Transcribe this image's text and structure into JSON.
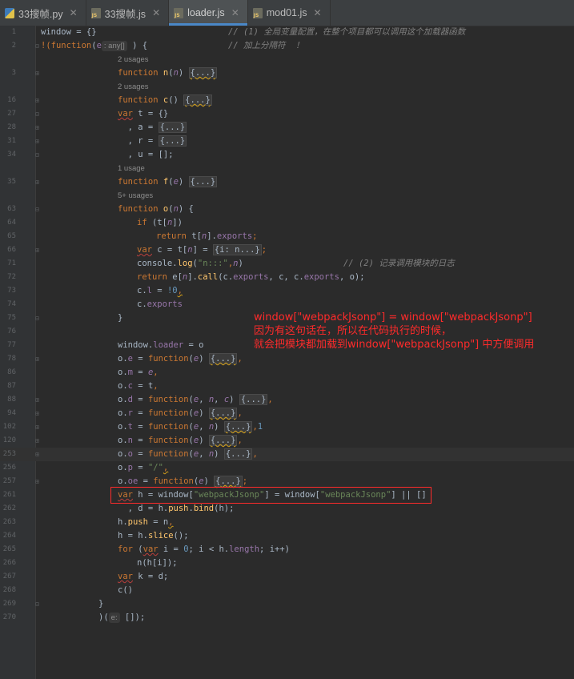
{
  "tabs": [
    {
      "label": "33搜帧.py",
      "icon": "python-file-icon",
      "active": false
    },
    {
      "label": "33搜帧.js",
      "icon": "js-file-icon",
      "active": false
    },
    {
      "label": "loader.js",
      "icon": "js-file-icon",
      "active": true
    },
    {
      "label": "mod01.js",
      "icon": "js-file-icon",
      "active": false
    }
  ],
  "lines": {
    "l1": {
      "num": "1",
      "t0": "window = {}",
      "comment": "// (1) 全局变量配置，在整个项目都可以调用这个加载器函数"
    },
    "l2": {
      "num": "2",
      "t0": "!(",
      "t1": "function",
      "t2": "(",
      "t3": "e",
      "hint": ": any[]",
      "t4": " ) {",
      "comment": "// 加上分隔符  ！"
    },
    "u1": "2 usages",
    "l3": {
      "num": "3",
      "t0": "function ",
      "t1": "n",
      "t2": "(",
      "t3": "n",
      "t4": ") ",
      "t5": "{...}"
    },
    "u2": "2 usages",
    "l16": {
      "num": "16",
      "t0": "function ",
      "t1": "c",
      "t2": "() ",
      "t3": "{...}"
    },
    "l27": {
      "num": "27",
      "t0": "var",
      "t1": " t = {}"
    },
    "l28": {
      "num": "28",
      "t0": "  , a = ",
      "t1": "{...}"
    },
    "l31": {
      "num": "31",
      "t0": "  , r = ",
      "t1": "{...}"
    },
    "l34": {
      "num": "34",
      "t0": "  , u = [];"
    },
    "u3": "1 usage",
    "l35": {
      "num": "35",
      "t0": "function ",
      "t1": "f",
      "t2": "(",
      "t3": "e",
      "t4": ") ",
      "t5": "{...}"
    },
    "u4": "5+ usages",
    "l63": {
      "num": "63",
      "t0": "function ",
      "t1": "o",
      "t2": "(",
      "t3": "n",
      "t4": ") {"
    },
    "l64": {
      "num": "64",
      "t0": "if",
      "t1": " (t[",
      "t2": "n",
      "t3": "])"
    },
    "l65": {
      "num": "65",
      "t0": "return",
      "t1": " t[",
      "t2": "n",
      "t3": "].",
      "t4": "exports",
      "t5": ";"
    },
    "l66": {
      "num": "66",
      "t0": "var",
      "t1": " c = t[",
      "t2": "n",
      "t3": "] = ",
      "t4": "{i: n...}",
      "t5": ";"
    },
    "l71": {
      "num": "71",
      "t0": "console.",
      "t1": "log",
      "t2": "(",
      "t3": "\"n:::\"",
      "t4": ",",
      "t5": "n",
      "t6": ")",
      "comment": "// (2) 记录调用模块的日志"
    },
    "l72": {
      "num": "72",
      "t0": "return",
      "t1": " e[",
      "t2": "n",
      "t3": "].",
      "t4": "call",
      "t5": "(c.",
      "t6": "exports",
      "t7": ", c, c.",
      "t8": "exports",
      "t9": ", o);"
    },
    "l73": {
      "num": "73",
      "t0": "c.",
      "t1": "l",
      "t2": " = ",
      "t3": "!0",
      "t4": ","
    },
    "l74": {
      "num": "74",
      "t0": "c.",
      "t1": "exports"
    },
    "l75": {
      "num": "75",
      "t0": "}"
    },
    "l76": {
      "num": "76"
    },
    "l77": {
      "num": "77",
      "t0": "window.",
      "t1": "loader",
      "t2": " = o"
    },
    "l78": {
      "num": "78",
      "t0": "o.",
      "t1": "e",
      "t2": " = ",
      "t3": "function",
      "t4": "(",
      "t5": "e",
      "t6": ") ",
      "t7": "{...}",
      "t8": ","
    },
    "l86": {
      "num": "86",
      "t0": "o.",
      "t1": "m",
      "t2": " = ",
      "t3": "e",
      "t4": ","
    },
    "l87": {
      "num": "87",
      "t0": "o.",
      "t1": "c",
      "t2": " = ",
      "t3": "t",
      "t4": ","
    },
    "l88": {
      "num": "88",
      "t0": "o.",
      "t1": "d",
      "t2": " = ",
      "t3": "function",
      "t4": "(",
      "t5": "e",
      "t6": ", ",
      "t7": "n",
      "t8": ", ",
      "t9": "c",
      "t10": ") ",
      "t11": "{...}",
      "t12": ","
    },
    "l94": {
      "num": "94",
      "t0": "o.",
      "t1": "r",
      "t2": " = ",
      "t3": "function",
      "t4": "(",
      "t5": "e",
      "t6": ") ",
      "t7": "{...}",
      "t8": ","
    },
    "l102": {
      "num": "102",
      "t0": "o.",
      "t1": "t",
      "t2": " = ",
      "t3": "function",
      "t4": "(",
      "t5": "e",
      "t6": ", ",
      "t7": "n",
      "t8": ") ",
      "t9": "{...}",
      "t10": ",",
      "t11": "1"
    },
    "l120": {
      "num": "120",
      "t0": "o.",
      "t1": "n",
      "t2": " = ",
      "t3": "function",
      "t4": "(",
      "t5": "e",
      "t6": ") ",
      "t7": "{...}",
      "t8": ","
    },
    "l253": {
      "num": "253",
      "t0": "o.",
      "t1": "o",
      "t2": " = ",
      "t3": "function",
      "t4": "(",
      "t5": "e",
      "t6": ", ",
      "t7": "n",
      "t8": ") ",
      "t9": "{...}",
      "t10": ","
    },
    "l256": {
      "num": "256",
      "t0": "o.",
      "t1": "p",
      "t2": " = ",
      "t3": "\"/\"",
      "t4": ","
    },
    "l257": {
      "num": "257",
      "t0": "o.",
      "t1": "oe",
      "t2": " = ",
      "t3": "function",
      "t4": "(",
      "t5": "e",
      "t6": ") ",
      "t7": "{...}",
      "t8": ";"
    },
    "l261": {
      "num": "261",
      "t0": "var",
      "t1": " h = window[",
      "t2": "\"webpackJsonp\"",
      "t3": "] = window[",
      "t4": "\"webpackJsonp\"",
      "t5": "] || []"
    },
    "l262": {
      "num": "262",
      "t0": "  , d = h.",
      "t1": "push",
      "t2": ".",
      "t3": "bind",
      "t4": "(h);"
    },
    "l263": {
      "num": "263",
      "t0": "h.",
      "t1": "push",
      "t2": " = ",
      "t3": "n",
      "t4": ","
    },
    "l264": {
      "num": "264",
      "t0": "h = h.",
      "t1": "slice",
      "t2": "();"
    },
    "l265": {
      "num": "265",
      "t0": "for",
      "t1": " (",
      "t2": "var",
      "t3": " i = ",
      "t4": "0",
      "t5": "; i < h.",
      "t6": "length",
      "t7": "; i++)"
    },
    "l266": {
      "num": "266",
      "t0": "n(h[i]);"
    },
    "l267": {
      "num": "267",
      "t0": "var",
      "t1": " k = d;"
    },
    "l268": {
      "num": "268",
      "t0": "c()"
    },
    "l269": {
      "num": "269",
      "t0": "}"
    },
    "l270": {
      "num": "270",
      "t0": ")(",
      "hint": "e:",
      "t1": " []);"
    }
  },
  "annotation": {
    "line1": "window[\"webpackJsonp\"] = window[\"webpackJsonp\"]",
    "line2": "因为有这句话在，所以在代码执行的时候，",
    "line3": "就会把模块都加载到window[\"webpackJsonp\"] 中方便调用",
    "color": "#ff2b2b"
  }
}
